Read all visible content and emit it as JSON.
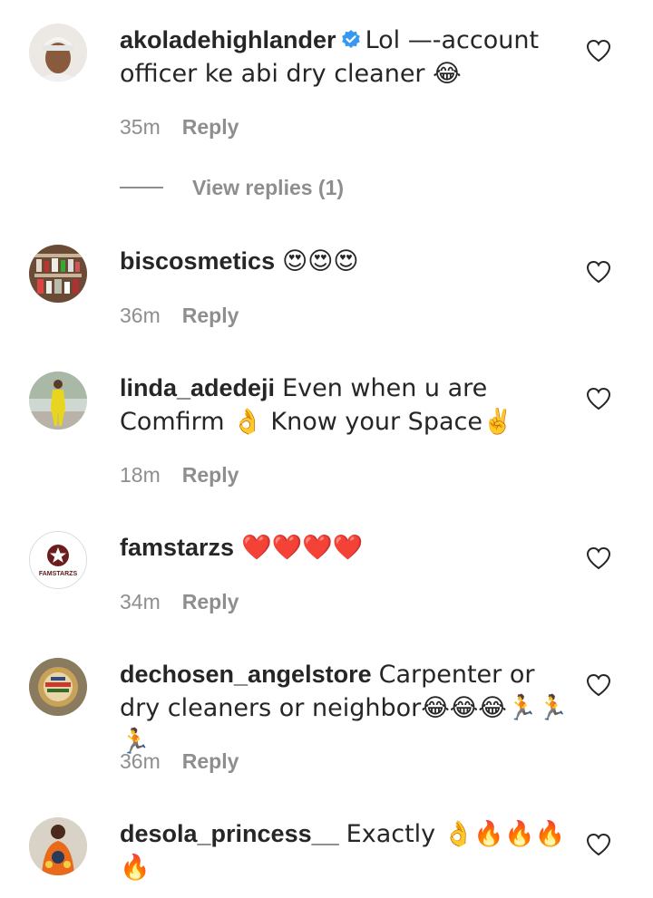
{
  "comments": [
    {
      "username": "akoladehighlander",
      "verified": true,
      "text": "Lol —-account officer ke abi dry cleaner 😂",
      "time": "35m",
      "reply_label": "Reply",
      "avatar_icon": "person-with-cap-avatar",
      "view_replies": "View replies (1)"
    },
    {
      "username": "biscosmetics",
      "verified": false,
      "text": "😍😍😍",
      "time": "36m",
      "reply_label": "Reply",
      "avatar_icon": "cosmetics-shelf-avatar"
    },
    {
      "username": "linda_adedeji",
      "verified": false,
      "text": "Even when u are Comfirm 👌 Know your Space✌️",
      "time": "18m",
      "reply_label": "Reply",
      "avatar_icon": "woman-yellow-outfit-avatar"
    },
    {
      "username": "famstarzs",
      "verified": false,
      "text": "❤️❤️❤️❤️",
      "time": "34m",
      "reply_label": "Reply",
      "avatar_icon": "famstarzs-logo-avatar",
      "avatar_text": "FAMSTARZS"
    },
    {
      "username": "dechosen_angelstore",
      "verified": false,
      "text": "Carpenter or dry cleaners or neighbor😂😂😂🏃🏃🏃",
      "time": "36m",
      "reply_label": "Reply",
      "avatar_icon": "store-logo-avatar"
    },
    {
      "username": "desola_princess__",
      "verified": false,
      "text": "Exactly 👌🔥🔥🔥🔥",
      "avatar_icon": "woman-orange-dress-avatar"
    }
  ],
  "colors": {
    "text": "#262626",
    "secondary": "#8e8e8e",
    "verified_blue": "#3897f0",
    "background": "#ffffff"
  }
}
